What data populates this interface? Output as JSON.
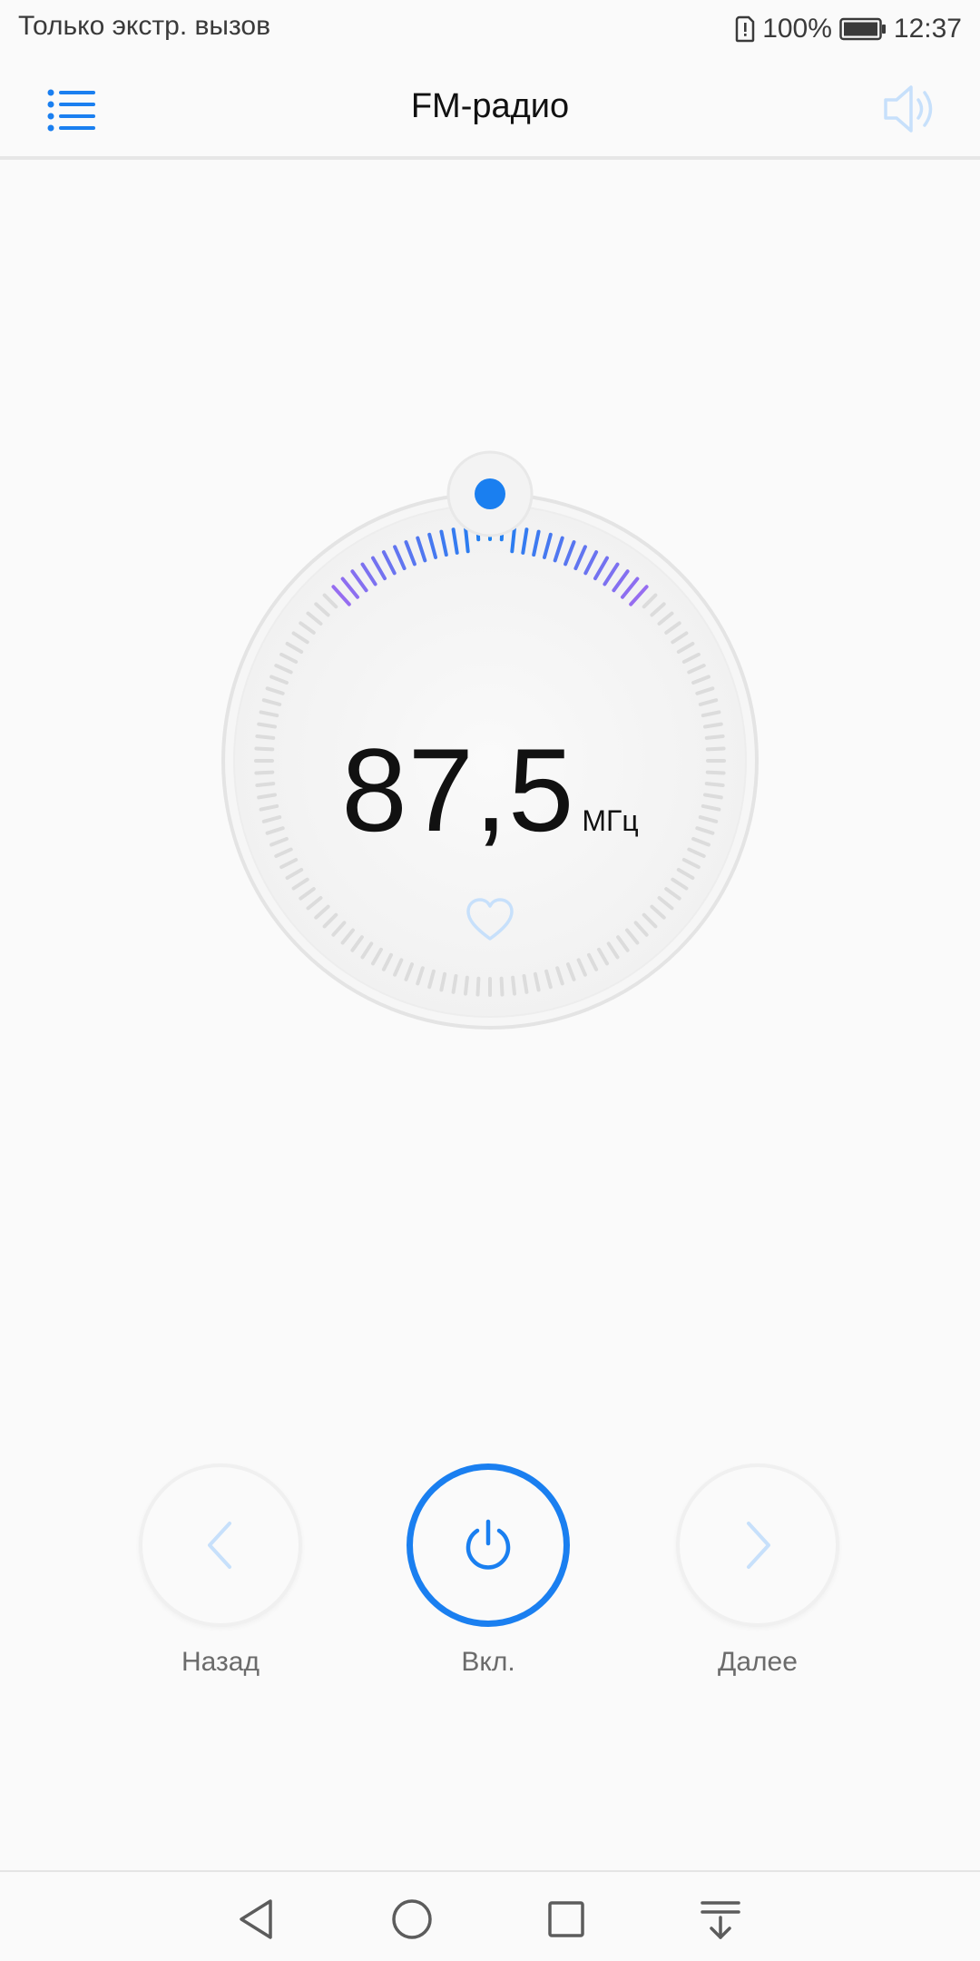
{
  "status": {
    "left_text": "Только экстр. вызов",
    "battery_percent": "100%",
    "time": "12:37",
    "icons": [
      "sim-alert-icon",
      "battery-icon"
    ]
  },
  "app_bar": {
    "title": "FM-радио",
    "icons": [
      "list-menu-icon",
      "speaker-icon"
    ]
  },
  "tuner": {
    "frequency": "87,5",
    "unit": "МГц",
    "favorite_icon": "heart-outline-icon"
  },
  "controls": {
    "prev_label": "Назад",
    "power_label": "Вкл.",
    "next_label": "Далее",
    "icons": [
      "chevron-left-icon",
      "power-icon",
      "chevron-right-icon"
    ]
  },
  "nav": {
    "icons": [
      "back-icon",
      "home-icon",
      "recents-icon",
      "notifications-pull-icon"
    ]
  },
  "colors": {
    "accent": "#1a7ff0",
    "accent_light": "#c7e0fb",
    "tick_gray": "#dcdcdc",
    "tick_purple": "#9c6cf0",
    "text": "#111111",
    "label": "#6b6b6b"
  }
}
